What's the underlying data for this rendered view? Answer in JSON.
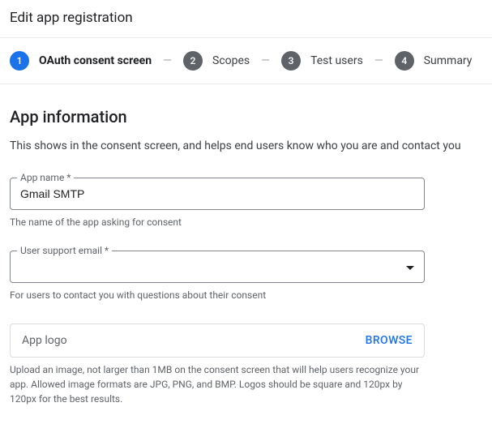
{
  "header": {
    "title": "Edit app registration"
  },
  "stepper": {
    "steps": [
      {
        "num": "1",
        "label": "OAuth consent screen",
        "active": true
      },
      {
        "num": "2",
        "label": "Scopes",
        "active": false
      },
      {
        "num": "3",
        "label": "Test users",
        "active": false
      },
      {
        "num": "4",
        "label": "Summary",
        "active": false
      }
    ],
    "sep": "—"
  },
  "section": {
    "title": "App information",
    "desc": "This shows in the consent screen, and helps end users know who you are and contact you"
  },
  "fields": {
    "appName": {
      "label": "App name *",
      "value": "Gmail SMTP",
      "helper": "The name of the app asking for consent"
    },
    "supportEmail": {
      "label": "User support email *",
      "value": "",
      "helper": "For users to contact you with questions about their consent"
    },
    "appLogo": {
      "placeholder": "App logo",
      "browse": "BROWSE",
      "helper": "Upload an image, not larger than 1MB on the consent screen that will help users recognize your app. Allowed image formats are JPG, PNG, and BMP. Logos should be square and 120px by 120px for the best results."
    }
  }
}
